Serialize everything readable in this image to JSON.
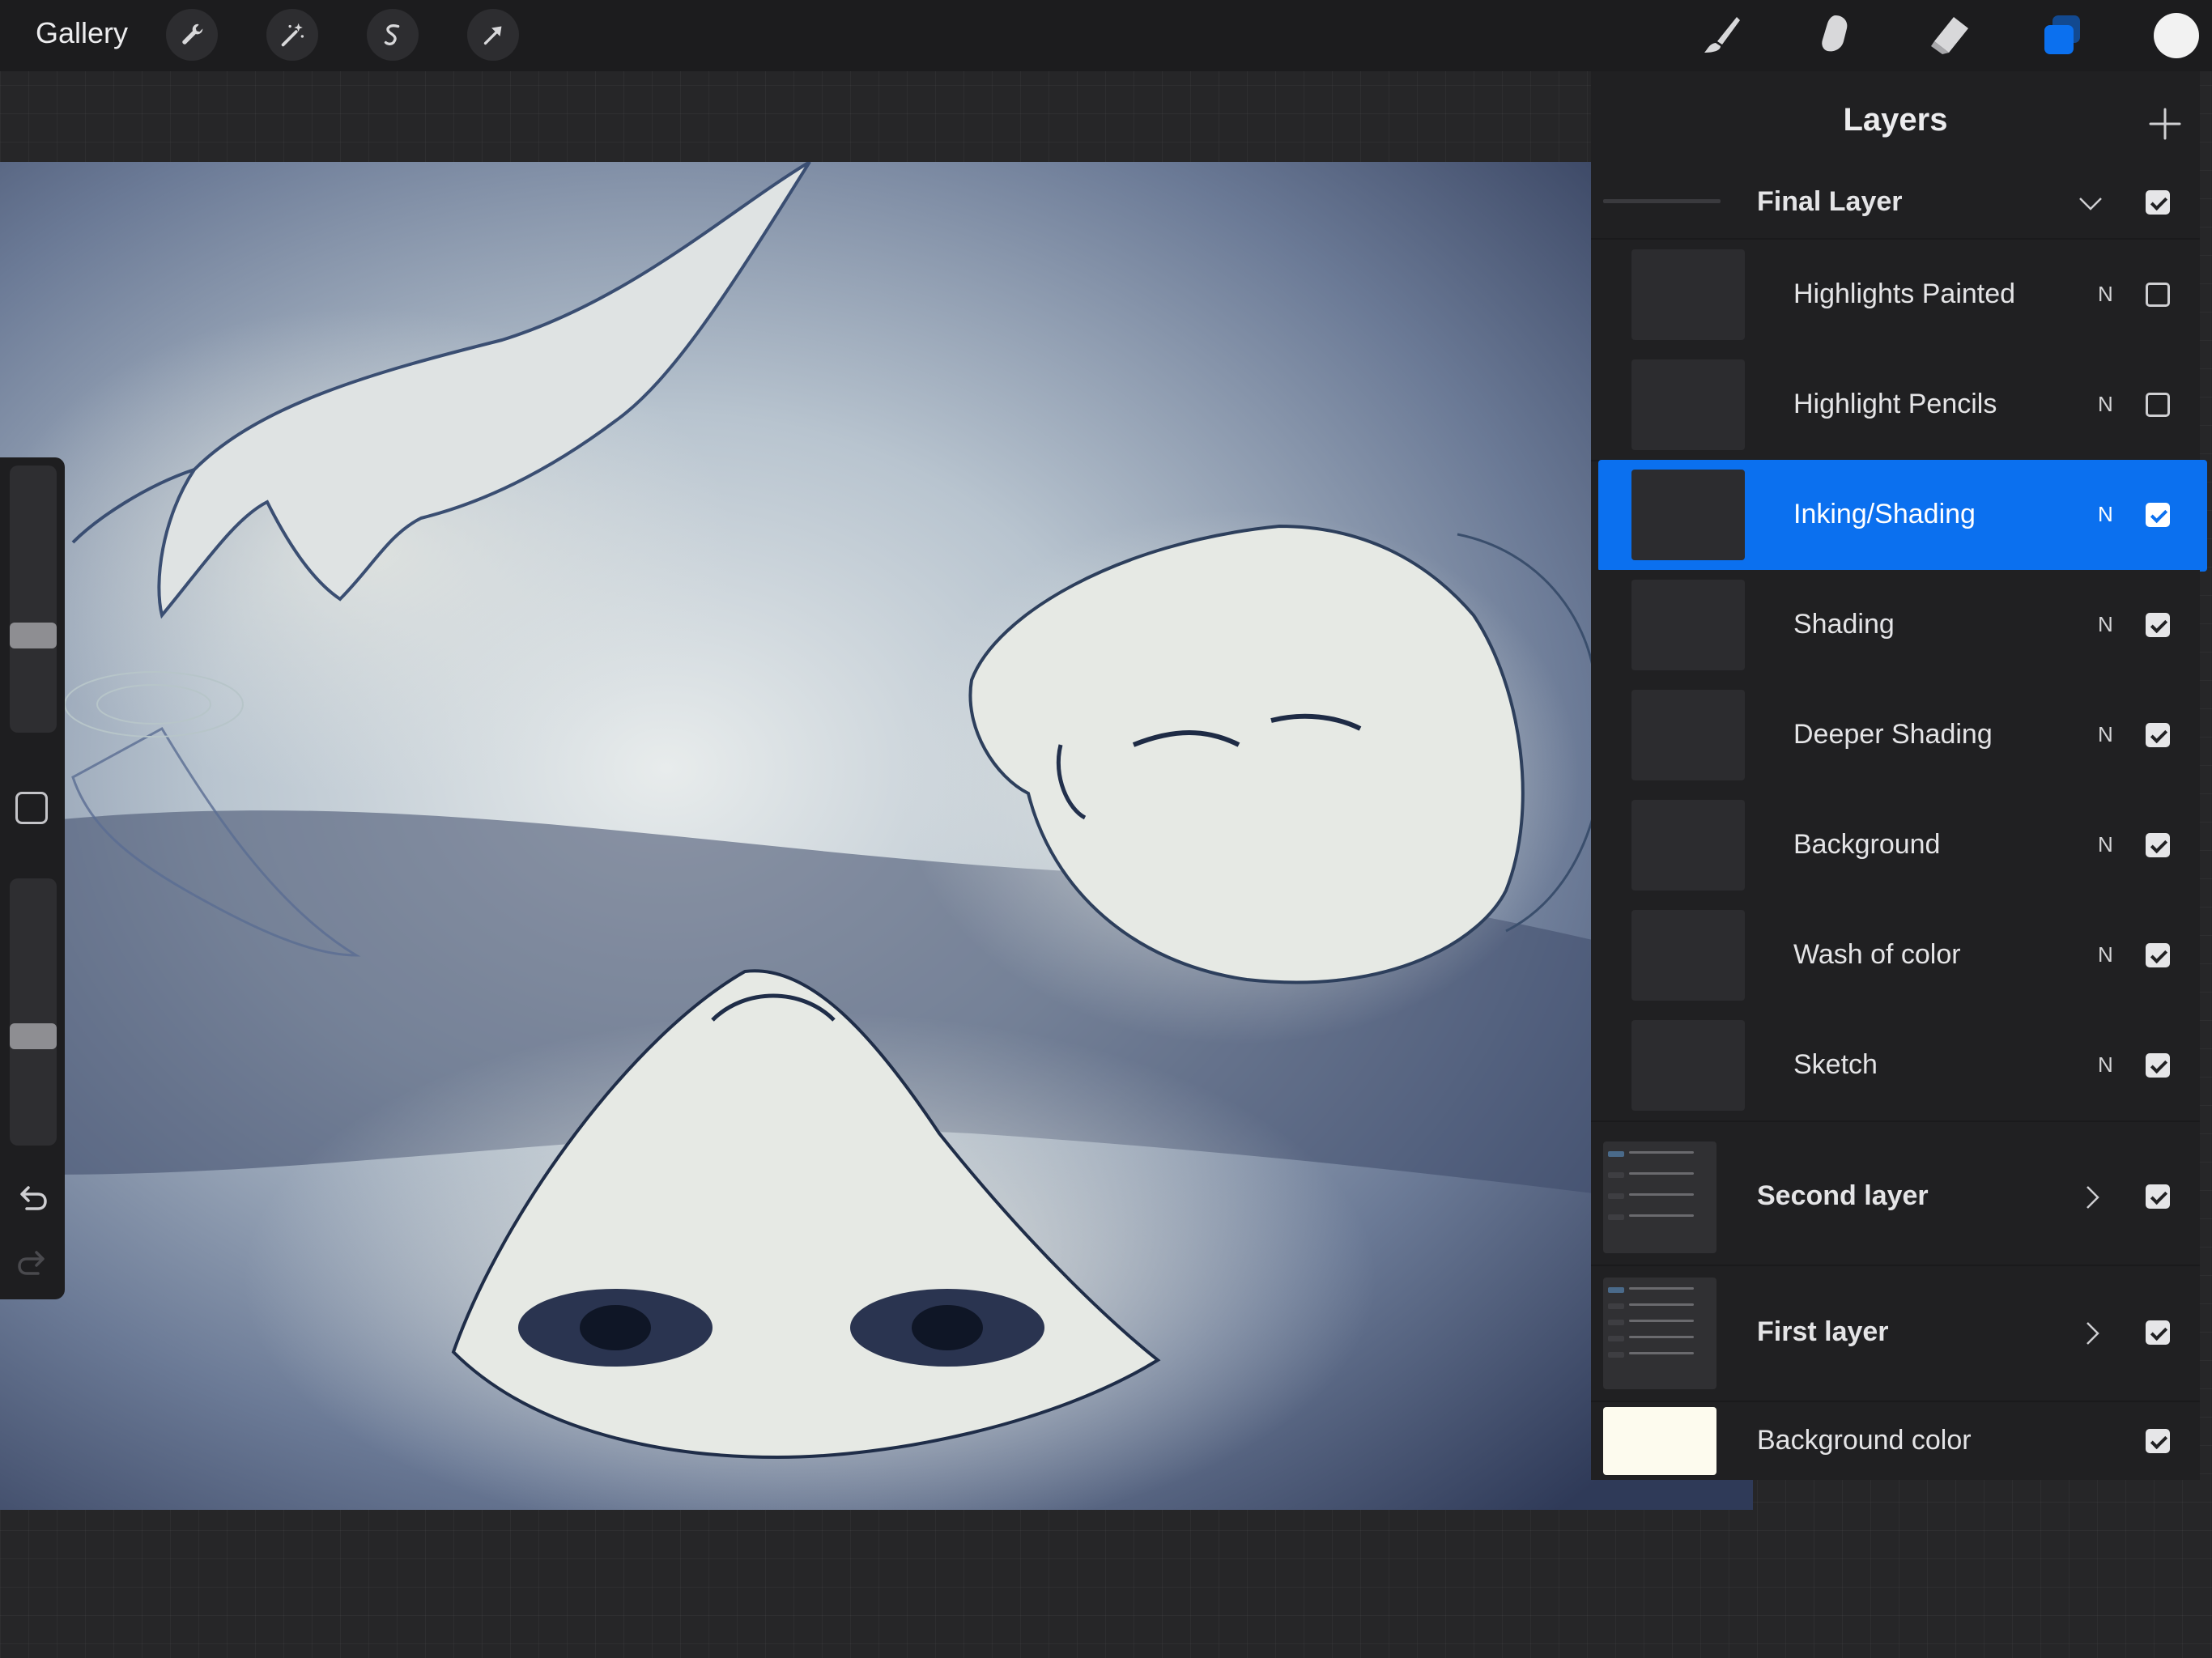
{
  "topbar": {
    "gallery_label": "Gallery",
    "left_tools": [
      "wrench-icon",
      "magic-wand-icon",
      "selection-s-icon",
      "transform-arrow-icon"
    ],
    "right_tools": [
      "brush-icon",
      "smudge-icon",
      "eraser-icon",
      "layers-icon"
    ],
    "active_tool": "layers-icon",
    "accent_color": "#0b70ef",
    "current_color": "#f2f2f2"
  },
  "sidebar": {
    "brush_size_level": 0.35,
    "opacity_level": 0.4
  },
  "layers_panel": {
    "title": "Layers",
    "groups": [
      {
        "name": "Final Layer",
        "expanded": true,
        "visible": true,
        "layers": [
          {
            "name": "Highlights Painted",
            "mode": "N",
            "visible": false,
            "selected": false
          },
          {
            "name": "Highlight Pencils",
            "mode": "N",
            "visible": false,
            "selected": false
          },
          {
            "name": "Inking/Shading",
            "mode": "N",
            "visible": true,
            "selected": true
          },
          {
            "name": "Shading",
            "mode": "N",
            "visible": true,
            "selected": false
          },
          {
            "name": "Deeper Shading",
            "mode": "N",
            "visible": true,
            "selected": false
          },
          {
            "name": "Background",
            "mode": "N",
            "visible": true,
            "selected": false
          },
          {
            "name": "Wash of color",
            "mode": "N",
            "visible": true,
            "selected": false
          },
          {
            "name": "Sketch",
            "mode": "N",
            "visible": true,
            "selected": false
          }
        ]
      },
      {
        "name": "Second layer",
        "expanded": false,
        "visible": true
      },
      {
        "name": "First layer",
        "expanded": false,
        "visible": true
      }
    ],
    "background_color": {
      "name": "Background color",
      "visible": true,
      "color": "#fdfbee"
    }
  }
}
